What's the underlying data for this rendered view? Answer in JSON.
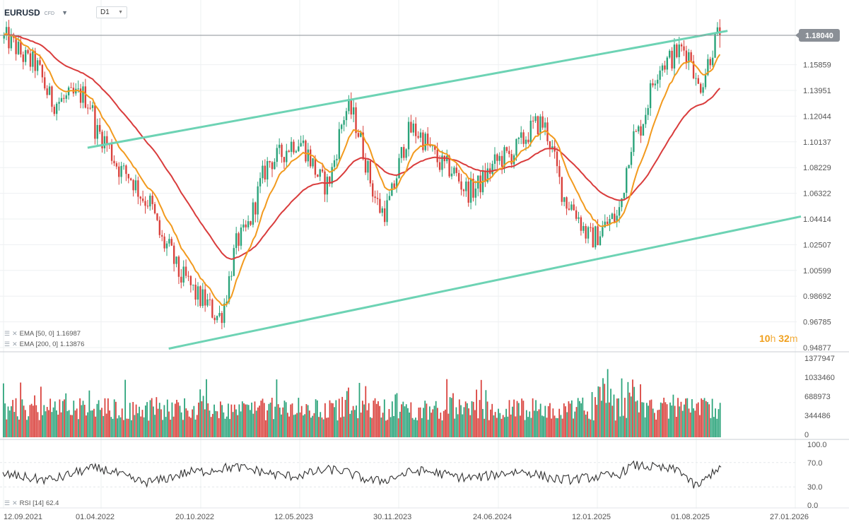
{
  "header": {
    "symbol": "EURUSD",
    "symbol_type": "CFD",
    "timeframe": "D1"
  },
  "indicators": {
    "ema50": {
      "label": "EMA [50, 0]",
      "value": "1.16987",
      "color": "#f29a1e"
    },
    "ema200": {
      "label": "EMA [200, 0]",
      "value": "1.13876",
      "color": "#d93c3c"
    },
    "rsi": {
      "label": "RSI [14]",
      "value": "62.4"
    }
  },
  "timer": {
    "hours": "10",
    "h_unit": "h",
    "minutes": "32",
    "m_unit": "m"
  },
  "chart_data": {
    "type": "candlestick",
    "instrument": "EURUSD",
    "timeframe": "D1",
    "price_axis": {
      "ylim": [
        0.94877,
        1.1804
      ],
      "ticks": [
        "1.15859",
        "1.13951",
        "1.12044",
        "1.10137",
        "1.08229",
        "1.06322",
        "1.04414",
        "1.02507",
        "1.00599",
        "0.98692",
        "0.96785",
        "0.94877"
      ]
    },
    "current_price": {
      "label": "1.18040",
      "value": 1.1804,
      "color": "#8a8f96"
    },
    "x_axis": {
      "ticks": [
        "12.09.2021",
        "01.04.2022",
        "20.10.2022",
        "12.05.2023",
        "30.11.2023",
        "24.06.2024",
        "12.01.2025",
        "01.08.2025",
        "27.01.2026"
      ]
    },
    "price_anchors": [
      {
        "t": 0.0,
        "v": 1.178
      },
      {
        "t": 0.04,
        "v": 1.16
      },
      {
        "t": 0.07,
        "v": 1.131
      },
      {
        "t": 0.11,
        "v": 1.136
      },
      {
        "t": 0.12,
        "v": 1.13
      },
      {
        "t": 0.13,
        "v": 1.108
      },
      {
        "t": 0.17,
        "v": 1.078
      },
      {
        "t": 0.2,
        "v": 1.058
      },
      {
        "t": 0.225,
        "v": 1.025
      },
      {
        "t": 0.25,
        "v": 1.0
      },
      {
        "t": 0.275,
        "v": 0.985
      },
      {
        "t": 0.3,
        "v": 0.972
      },
      {
        "t": 0.33,
        "v": 1.03
      },
      {
        "t": 0.375,
        "v": 1.088
      },
      {
        "t": 0.41,
        "v": 1.102
      },
      {
        "t": 0.45,
        "v": 1.07
      },
      {
        "t": 0.48,
        "v": 1.125
      },
      {
        "t": 0.53,
        "v": 1.05
      },
      {
        "t": 0.57,
        "v": 1.11
      },
      {
        "t": 0.62,
        "v": 1.082
      },
      {
        "t": 0.65,
        "v": 1.065
      },
      {
        "t": 0.7,
        "v": 1.09
      },
      {
        "t": 0.75,
        "v": 1.115
      },
      {
        "t": 0.79,
        "v": 1.055
      },
      {
        "t": 0.82,
        "v": 1.03
      },
      {
        "t": 0.855,
        "v": 1.045
      },
      {
        "t": 0.88,
        "v": 1.105
      },
      {
        "t": 0.92,
        "v": 1.16
      },
      {
        "t": 0.95,
        "v": 1.17
      },
      {
        "t": 0.96,
        "v": 1.165
      },
      {
        "t": 0.968,
        "v": 1.142
      },
      {
        "t": 1.0,
        "v": 1.1804
      }
    ],
    "candles_count": 300,
    "trend_channel": {
      "upper": {
        "from": {
          "t": 0.118,
          "v": 1.097
        },
        "to": {
          "t": 0.95,
          "v": 1.179
        }
      },
      "lower": {
        "from": {
          "t": 0.231,
          "v": 0.948
        },
        "to": {
          "t": 1.05,
          "v": 1.046
        }
      },
      "color": "#6dd3b4"
    },
    "volume_axis": {
      "ylim": [
        0,
        1377947
      ],
      "ticks": [
        "1377947",
        "1033460",
        "688973",
        "344486",
        "0"
      ]
    },
    "volume_colors": {
      "up": "#2aa37a",
      "down": "#d9413c"
    },
    "rsi_axis": {
      "ylim": [
        0,
        100
      ],
      "ticks": [
        "100.0",
        "70.0",
        "30.0",
        "0.0"
      ]
    },
    "rsi_anchors": [
      {
        "t": 0.0,
        "v": 50
      },
      {
        "t": 0.06,
        "v": 42
      },
      {
        "t": 0.13,
        "v": 60
      },
      {
        "t": 0.2,
        "v": 38
      },
      {
        "t": 0.27,
        "v": 55
      },
      {
        "t": 0.32,
        "v": 62
      },
      {
        "t": 0.4,
        "v": 48
      },
      {
        "t": 0.46,
        "v": 58
      },
      {
        "t": 0.52,
        "v": 40
      },
      {
        "t": 0.58,
        "v": 56
      },
      {
        "t": 0.65,
        "v": 45
      },
      {
        "t": 0.72,
        "v": 55
      },
      {
        "t": 0.78,
        "v": 42
      },
      {
        "t": 0.85,
        "v": 48
      },
      {
        "t": 0.88,
        "v": 65
      },
      {
        "t": 0.94,
        "v": 58
      },
      {
        "t": 0.965,
        "v": 32
      },
      {
        "t": 1.0,
        "v": 62.4
      }
    ]
  }
}
